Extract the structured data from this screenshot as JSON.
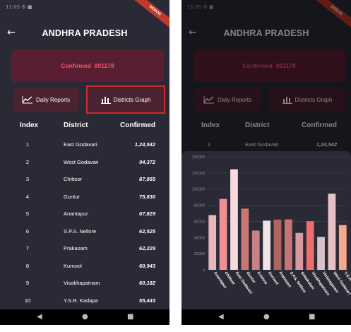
{
  "status_bar": {
    "text": "11:05 ⚙ ■"
  },
  "debug_ribbon": "DEBUG",
  "header": {
    "title": "ANDHRA PRADESH",
    "back_icon": "arrow-left-icon"
  },
  "confirmed": {
    "label": "Confirmed",
    "value": "891178"
  },
  "buttons": {
    "daily_reports": "Daily Reports",
    "districts_graph": "Districts Graph"
  },
  "table": {
    "columns": [
      "Index",
      "District",
      "Confirmed"
    ],
    "rows": [
      {
        "index": "1",
        "district": "East Godavari",
        "confirmed": "1,24,542"
      },
      {
        "index": "2",
        "district": "West Godavari",
        "confirmed": "94,372"
      },
      {
        "index": "3",
        "district": "Chittoor",
        "confirmed": "87,855"
      },
      {
        "index": "4",
        "district": "Guntur",
        "confirmed": "75,830"
      },
      {
        "index": "5",
        "district": "Anantapur",
        "confirmed": "67,829"
      },
      {
        "index": "6",
        "district": "S.P.S. Nellore",
        "confirmed": "62,525"
      },
      {
        "index": "7",
        "district": "Prakasam",
        "confirmed": "62,229"
      },
      {
        "index": "8",
        "district": "Kurnool",
        "confirmed": "60,943"
      },
      {
        "index": "9",
        "district": "Visakhapatnam",
        "confirmed": "60,182"
      },
      {
        "index": "10",
        "district": "Y.S.R. Kadapa",
        "confirmed": "55,443"
      }
    ]
  },
  "nav_bar": {
    "back": "◀",
    "home": "●",
    "recents": "■"
  },
  "colors": {
    "background": "#2a2a36",
    "confirmed_bg": "#5a1e32",
    "confirmed_text": "#ff4f6f",
    "button_bg": "#4a2232",
    "highlight": "#d42a2a"
  },
  "chart_data": {
    "type": "bar",
    "categories": [
      "Anantapur",
      "Chittoor",
      "East Godavari",
      "Guntur",
      "Krishna",
      "Kurnool",
      "Prakasam",
      "S.P.S. Nellore",
      "Srikakulam",
      "Visakhapatnam",
      "Vizianagaram",
      "West Godavari",
      "Y.S.R. Kadapa"
    ],
    "values": [
      67829,
      87855,
      124542,
      75830,
      48600,
      60943,
      62229,
      62525,
      45800,
      60182,
      40800,
      94372,
      55443
    ],
    "colors": [
      "#e7b7bb",
      "#ef8f93",
      "#f6dade",
      "#c97774",
      "#c98088",
      "#efe3e6",
      "#b06660",
      "#c67474",
      "#d89aa0",
      "#ee6e6e",
      "#d7c3c7",
      "#e6c0c4",
      "#f7a88a"
    ],
    "yticks": [
      "0",
      "20000",
      "40000",
      "60000",
      "80000",
      "100000",
      "120000",
      "140000"
    ],
    "ylim": [
      0,
      140000
    ],
    "grid": true
  }
}
